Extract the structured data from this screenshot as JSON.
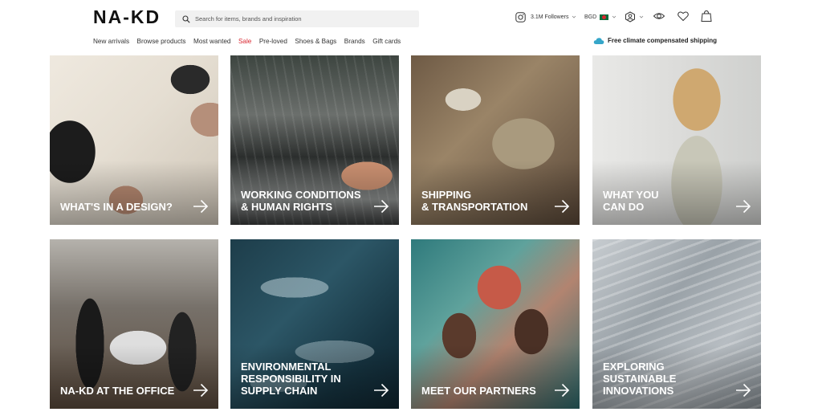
{
  "header": {
    "logo": "NA-KD",
    "search_placeholder": "Search for items, brands and inspiration",
    "instagram_followers": "3.1M Followers",
    "currency": "BGD"
  },
  "nav": {
    "items": [
      "New arrivals",
      "Browse products",
      "Most wanted",
      "Sale",
      "Pre-loved",
      "Shoes & Bags",
      "Brands",
      "Gift cards"
    ],
    "shipping_notice": "Free climate compensated shipping"
  },
  "tiles": [
    {
      "label": "WHAT'S IN A DESIGN?"
    },
    {
      "label": "WORKING CONDITIONS\n& HUMAN RIGHTS"
    },
    {
      "label": "SHIPPING\n& TRANSPORTATION"
    },
    {
      "label": "WHAT YOU\nCAN DO"
    },
    {
      "label": "NA-KD AT THE OFFICE"
    },
    {
      "label": "ENVIRONMENTAL\nRESPONSIBILITY IN\nSUPPLY CHAIN"
    },
    {
      "label": "MEET OUR PARTNERS"
    },
    {
      "label": "EXPLORING\nSUSTAINABLE\nINNOVATIONS"
    }
  ],
  "colors": {
    "sale": "#d8262f",
    "text": "#1a1a1a",
    "search_bg": "#f1f1f1",
    "cloud_icon": "#35a6c9"
  }
}
